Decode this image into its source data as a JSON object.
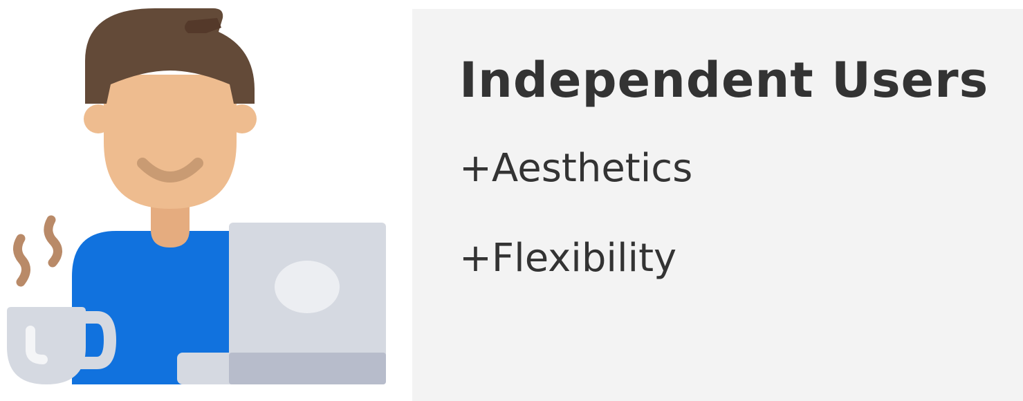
{
  "card": {
    "title": "Independent Users",
    "features": [
      "+Aesthetics",
      "+Flexibility"
    ]
  },
  "illustration": {
    "icon": "person-with-laptop-and-coffee-icon"
  },
  "colors": {
    "card_background": "#f3f3f3",
    "text": "#333333",
    "hair": "#634a38",
    "skin": "#eebc8f",
    "neck": "#e5ac7f",
    "shirt": "#1172de",
    "laptop": "#d5d9e1",
    "steam": "#b98a68"
  }
}
